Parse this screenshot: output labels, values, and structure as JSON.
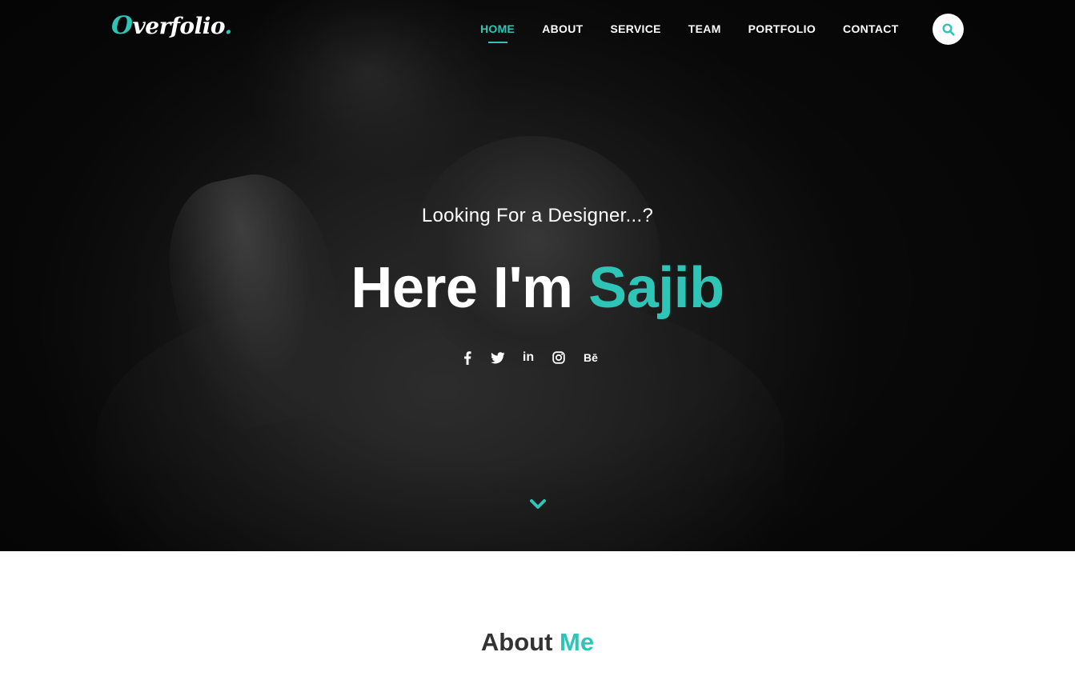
{
  "brand": {
    "logo_initial": "O",
    "logo_rest": "verfolio",
    "logo_dot": ".",
    "accent_color": "#2ec4b6"
  },
  "nav": {
    "items": [
      {
        "label": "HOME",
        "active": true
      },
      {
        "label": "ABOUT",
        "active": false
      },
      {
        "label": "SERVICE",
        "active": false
      },
      {
        "label": "TEAM",
        "active": false
      },
      {
        "label": "PORTFOLIO",
        "active": false
      },
      {
        "label": "CONTACT",
        "active": false
      }
    ],
    "search_icon": "search-icon"
  },
  "hero": {
    "tagline": "Looking For a Designer...?",
    "headline_prefix": "Here I'm ",
    "headline_name": "Sajib",
    "socials": [
      {
        "icon": "facebook-icon"
      },
      {
        "icon": "twitter-icon"
      },
      {
        "icon": "linkedin-icon",
        "text": "in"
      },
      {
        "icon": "instagram-icon"
      },
      {
        "icon": "behance-icon",
        "text": "Bē"
      }
    ],
    "scroll_icon": "chevron-down-icon"
  },
  "about": {
    "title_main": "About ",
    "title_accent": "Me"
  }
}
